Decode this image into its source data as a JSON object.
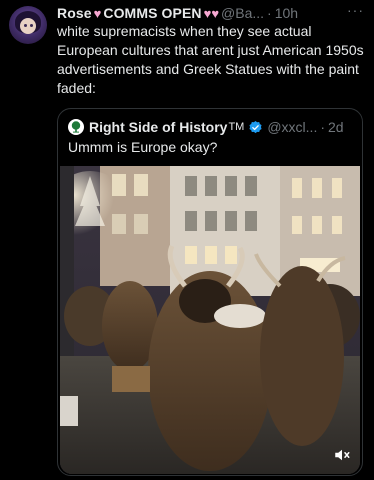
{
  "tweet": {
    "author_name": "Rose",
    "author_tag": "COMMS OPEN",
    "handle": "@Ba...",
    "separator": "·",
    "time": "10h",
    "more_label": "···",
    "text": "white supremacists when they see actual European cultures that arent just American 1950s advertisements and Greek Statues with the paint faded:"
  },
  "quote": {
    "author_name": "Right Side of History",
    "tm": "TM",
    "handle": "@xxcl...",
    "separator": "·",
    "time": "2d",
    "text": "Ummm is Europe okay?"
  },
  "media": {
    "type": "video",
    "description_icon": "mute-icon"
  },
  "colors": {
    "background": "#000000",
    "text_primary": "#e7e9ea",
    "text_secondary": "#71767b",
    "border": "#2f3336",
    "verified": "#1d9bf0",
    "heart": "#f7a8d2"
  }
}
